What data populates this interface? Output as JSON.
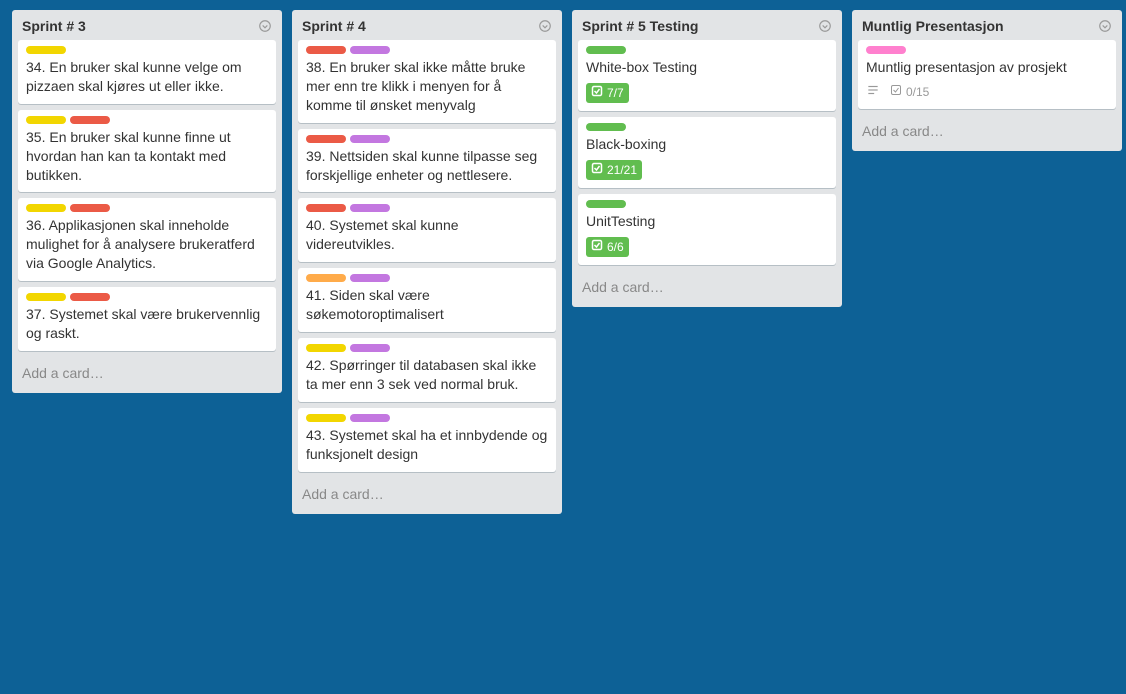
{
  "add_card_label": "Add a card…",
  "lists": [
    {
      "title": "Sprint # 3",
      "cards": [
        {
          "labels": [
            "yellow"
          ],
          "text": "34. En bruker skal kunne velge om pizzaen skal kjøres ut eller ikke."
        },
        {
          "labels": [
            "yellow",
            "red"
          ],
          "text": "35. En bruker skal kunne finne ut hvordan han kan ta kontakt med butikken."
        },
        {
          "labels": [
            "yellow",
            "red"
          ],
          "text": "36. Applikasjonen skal inneholde mulighet for å analysere brukeratferd via Google Analytics."
        },
        {
          "labels": [
            "yellow",
            "red"
          ],
          "text": "37. Systemet skal være brukervennlig og raskt."
        }
      ]
    },
    {
      "title": "Sprint # 4",
      "cards": [
        {
          "labels": [
            "red",
            "purple"
          ],
          "text": "38. En bruker skal ikke måtte bruke mer enn tre klikk i menyen for  å komme til ønsket menyvalg"
        },
        {
          "labels": [
            "red",
            "purple"
          ],
          "text": "39. Nettsiden skal kunne tilpasse seg forskjellige enheter og nettlesere."
        },
        {
          "labels": [
            "red",
            "purple"
          ],
          "text": "40. Systemet skal kunne videreutvikles."
        },
        {
          "labels": [
            "orange",
            "purple"
          ],
          "text": "41. Siden skal være søkemotoroptimalisert"
        },
        {
          "labels": [
            "yellow",
            "purple"
          ],
          "text": "42. Spørringer til databasen skal ikke ta mer enn 3 sek ved normal bruk."
        },
        {
          "labels": [
            "yellow",
            "purple"
          ],
          "text": "43. Systemet skal ha et innbydende og funksjonelt design"
        }
      ]
    },
    {
      "title": "Sprint # 5 Testing",
      "cards": [
        {
          "labels": [
            "green"
          ],
          "text": "White-box Testing",
          "checklist": "7/7",
          "checklist_complete": true
        },
        {
          "labels": [
            "green"
          ],
          "text": "Black-boxing",
          "checklist": "21/21",
          "checklist_complete": true
        },
        {
          "labels": [
            "green"
          ],
          "text": "UnitTesting",
          "checklist": "6/6",
          "checklist_complete": true
        }
      ]
    },
    {
      "title": "Muntlig Presentasjon",
      "cards": [
        {
          "labels": [
            "pink"
          ],
          "text": "Muntlig presentasjon av prosjekt",
          "has_desc": true,
          "checklist": "0/15",
          "checklist_complete": false
        }
      ]
    }
  ]
}
